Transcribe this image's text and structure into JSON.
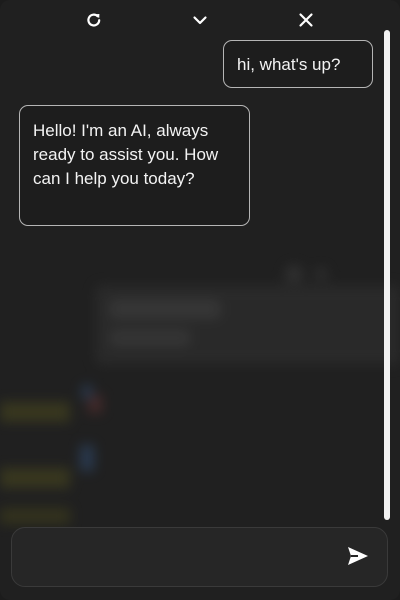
{
  "toolbar": {
    "refresh_icon": "refresh-icon",
    "collapse_icon": "chevron-down-icon",
    "close_icon": "close-icon"
  },
  "messages": [
    {
      "role": "user",
      "text": "hi, what's up?"
    },
    {
      "role": "assistant",
      "text": "Hello! I'm an AI, always ready to assist you. How can I help you today?"
    }
  ],
  "composer": {
    "placeholder": "",
    "value": "",
    "send_icon": "send-icon"
  },
  "colors": {
    "background": "#202020",
    "bubble_border": "#b5b5b5",
    "text": "#f3f3f3",
    "scrollbar": "#f2f2f2"
  }
}
